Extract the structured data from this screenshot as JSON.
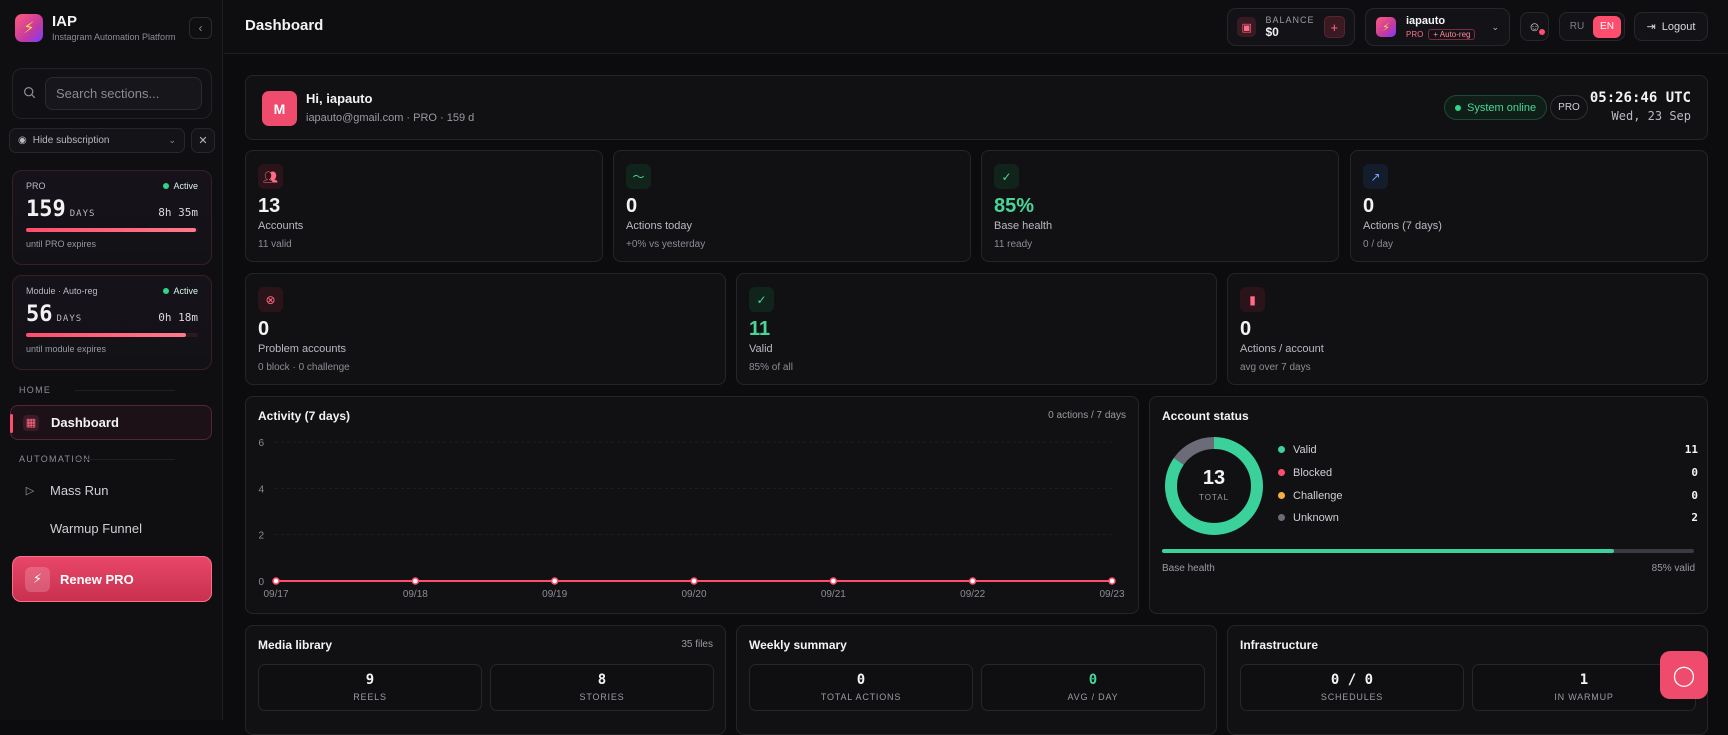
{
  "brand": {
    "title": "IAP",
    "subtitle": "Instagram Automation Platform"
  },
  "sidebar": {
    "search_placeholder": "Search sections...",
    "hide_subscription": "Hide subscription",
    "subscriptions": [
      {
        "label": "PRO",
        "status": "Active",
        "days": "159",
        "days_label": "DAYS",
        "time": "8h 35m",
        "until": "until PRO expires",
        "progress": 0.99
      },
      {
        "label": "Module · Auto-reg",
        "status": "Active",
        "days": "56",
        "days_label": "DAYS",
        "time": "0h 18m",
        "until": "until module expires",
        "progress": 0.93
      }
    ],
    "sections": {
      "home": "HOME",
      "automation": "AUTOMATION"
    },
    "items": {
      "dashboard": "Dashboard",
      "mass_run": "Mass Run",
      "warmup_funnel": "Warmup Funnel"
    },
    "renew": "Renew PRO"
  },
  "header": {
    "title": "Dashboard",
    "balance_label": "BALANCE",
    "balance_value": "$0",
    "user": {
      "name": "iapauto",
      "tier": "PRO",
      "module": "+ Auto-reg"
    },
    "lang": {
      "ru": "RU",
      "en": "EN"
    },
    "logout": "Logout"
  },
  "hero": {
    "initial": "M",
    "greeting": "Hi, iapauto",
    "sub": "iapauto@gmail.com · PRO · 159 d",
    "status": "System online",
    "plan": "PRO",
    "time": "05:26:46 UTC",
    "date": "Wed, 23 Sep"
  },
  "stats_row1": [
    {
      "value": "13",
      "label": "Accounts",
      "sub": "11 valid",
      "icon": "users-icon"
    },
    {
      "value": "0",
      "label": "Actions today",
      "sub": "+0% vs yesterday",
      "icon": "activity-icon"
    },
    {
      "value": "85%",
      "label": "Base health",
      "sub": "11 ready",
      "icon": "check-circle-icon"
    },
    {
      "value": "0",
      "label": "Actions (7 days)",
      "sub": "0 / day",
      "icon": "trending-up-icon"
    }
  ],
  "stats_row2": [
    {
      "value": "0",
      "label": "Problem accounts",
      "sub": "0 block · 0 challenge",
      "icon": "x-circle-icon"
    },
    {
      "value": "11",
      "label": "Valid",
      "sub": "85% of all",
      "icon": "check-circle-icon"
    },
    {
      "value": "0",
      "label": "Actions / account",
      "sub": "avg over 7 days",
      "icon": "bar-chart-icon"
    }
  ],
  "activity": {
    "title": "Activity (7 days)",
    "meta": "0 actions / 7 days"
  },
  "chart_data": {
    "type": "line",
    "title": "Activity (7 days)",
    "x": [
      "09/17",
      "09/18",
      "09/19",
      "09/20",
      "09/21",
      "09/22",
      "09/23"
    ],
    "series": [
      {
        "values": [
          0,
          0,
          0,
          0,
          0,
          0,
          0
        ]
      }
    ],
    "yticks": [
      "6",
      "4",
      "2",
      "0"
    ],
    "ylim": [
      0,
      6
    ],
    "grid": true,
    "color": "#ff4d6d"
  },
  "account_status": {
    "title": "Account status",
    "total": "13",
    "total_label": "TOTAL",
    "items": [
      {
        "label": "Valid",
        "value": "11",
        "color": "#3ad29a"
      },
      {
        "label": "Blocked",
        "value": "0",
        "color": "#ff4d6d"
      },
      {
        "label": "Challenge",
        "value": "0",
        "color": "#f5b03a"
      },
      {
        "label": "Unknown",
        "value": "2",
        "color": "#6c6c78"
      }
    ],
    "health_label": "Base health",
    "health_value": "85% valid",
    "health_fraction": 0.85
  },
  "media": {
    "title": "Media library",
    "meta": "35 files",
    "a_num": "9",
    "a_lbl": "REELS",
    "b_num": "8",
    "b_lbl": "STORIES"
  },
  "weekly": {
    "title": "Weekly summary",
    "a_num": "0",
    "a_lbl": "TOTAL ACTIONS",
    "b_num": "0",
    "b_lbl": "AVG / DAY"
  },
  "infra": {
    "title": "Infrastructure",
    "a_num": "0 / 0",
    "a_lbl": "SCHEDULES",
    "b_num": "1",
    "b_lbl": "IN WARMUP"
  }
}
